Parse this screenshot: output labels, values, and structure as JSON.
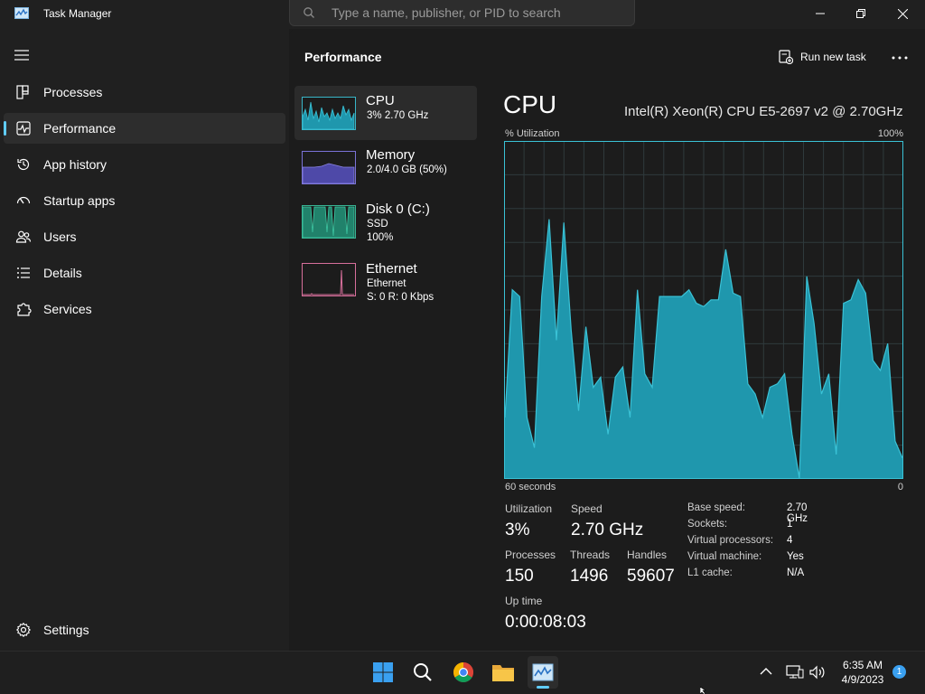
{
  "window": {
    "title": "Task Manager"
  },
  "search": {
    "placeholder": "Type a name, publisher, or PID to search"
  },
  "sidebar": {
    "items": [
      {
        "label": "Processes",
        "icon": "processes-grid-icon"
      },
      {
        "label": "Performance",
        "icon": "performance-chart-icon",
        "active": true
      },
      {
        "label": "App history",
        "icon": "history-icon"
      },
      {
        "label": "Startup apps",
        "icon": "startup-speedometer-icon"
      },
      {
        "label": "Users",
        "icon": "users-icon"
      },
      {
        "label": "Details",
        "icon": "details-list-icon"
      },
      {
        "label": "Services",
        "icon": "services-puzzle-icon"
      }
    ],
    "settings_label": "Settings"
  },
  "header": {
    "title": "Performance",
    "run_new_task": "Run new task"
  },
  "perf_list": [
    {
      "name": "CPU",
      "lines": [
        "3%  2.70 GHz"
      ],
      "color": "#38b6c8",
      "active": true
    },
    {
      "name": "Memory",
      "lines": [
        "2.0/4.0 GB (50%)"
      ],
      "color": "#7a72d6"
    },
    {
      "name": "Disk 0 (C:)",
      "lines": [
        "SSD",
        "100%"
      ],
      "color": "#37b393"
    },
    {
      "name": "Ethernet",
      "lines": [
        "Ethernet",
        "S: 0 R: 0 Kbps"
      ],
      "color": "#d76f9b"
    }
  ],
  "cpu": {
    "title": "CPU",
    "model": "Intel(R) Xeon(R) CPU E5-2697 v2 @ 2.70GHz",
    "y_label": "% Utilization",
    "y_max_label": "100%",
    "x_left_label": "60 seconds",
    "x_right_label": "0",
    "stats": {
      "utilization_label": "Utilization",
      "utilization": "3%",
      "speed_label": "Speed",
      "speed": "2.70 GHz",
      "processes_label": "Processes",
      "processes": "150",
      "threads_label": "Threads",
      "threads": "1496",
      "handles_label": "Handles",
      "handles": "59607",
      "uptime_label": "Up time",
      "uptime": "0:00:08:03"
    },
    "specs": [
      {
        "key": "Base speed:",
        "value": "2.70 GHz"
      },
      {
        "key": "Sockets:",
        "value": "1"
      },
      {
        "key": "Virtual processors:",
        "value": "4"
      },
      {
        "key": "Virtual machine:",
        "value": "Yes"
      },
      {
        "key": "L1 cache:",
        "value": "N/A"
      }
    ]
  },
  "chart_data": {
    "type": "area",
    "ylim": [
      0,
      100
    ],
    "x_direction": "60 seconds ago to now",
    "values": [
      18,
      56,
      54,
      18,
      9,
      54,
      77,
      41,
      76,
      44,
      20,
      45,
      27,
      30,
      13,
      30,
      33,
      18,
      56,
      31,
      27,
      54,
      54,
      54,
      54,
      56,
      52,
      51,
      53,
      53,
      68,
      55,
      54,
      28,
      25,
      18,
      27,
      28,
      31,
      13,
      0,
      60,
      46,
      25,
      31,
      7,
      52,
      53,
      59,
      55,
      35,
      32,
      40,
      11,
      6
    ],
    "colors": {
      "line": "#3ac2d6",
      "fill": "#1f97ad"
    }
  },
  "taskbar": {
    "apps": [
      "windows-start-icon",
      "search-icon",
      "chrome-icon",
      "file-explorer-icon",
      "task-manager-icon"
    ],
    "time": "6:35 AM",
    "date": "4/9/2023",
    "notification_count": "1"
  }
}
